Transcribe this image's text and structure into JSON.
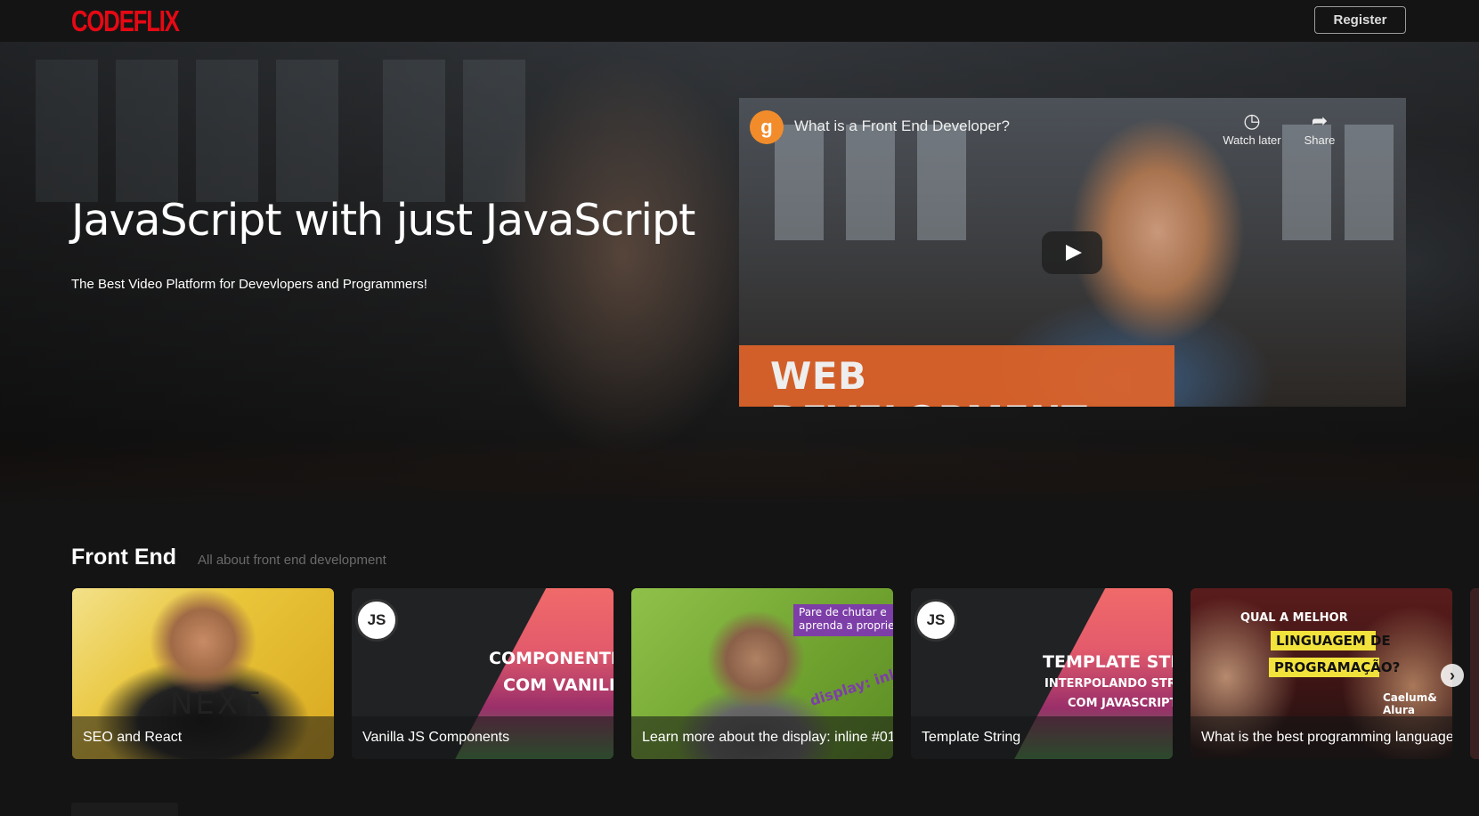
{
  "header": {
    "logo": "CODEFLIX",
    "register_label": "Register"
  },
  "hero": {
    "title": "JavaScript with just JavaScript",
    "subtitle": "The Best Video Platform for Devevlopers and Programmers!"
  },
  "video": {
    "channel_icon": "g",
    "title": "What is a Front End Developer?",
    "watch_later_label": "Watch later",
    "watch_later_icon": "clock-icon",
    "share_label": "Share",
    "share_icon": "share-arrow-icon",
    "banner_text": "WEB DEVELOPMENT"
  },
  "section": {
    "title": "Front End",
    "subtitle": "All about front end development"
  },
  "cards": [
    {
      "title": "SEO and React",
      "overlay": "NEXT"
    },
    {
      "title": "Vanilla JS Components",
      "overlay_line1": "COMPONENTIZAÇ",
      "overlay_line2": "COM VANILLAJS",
      "badge": "JS"
    },
    {
      "title": "Learn more about the display: inline #01",
      "overlay_line1": "Pare de chutar e",
      "overlay_line2": "aprenda a propriedade",
      "overlay_line3": "display: inline"
    },
    {
      "title": "Template String",
      "overlay_line1": "TEMPLATE STRIN",
      "overlay_line2": "INTERPOLANDO STRIN",
      "overlay_line3": "COM JAVASCRIPT",
      "badge": "JS"
    },
    {
      "title": "What is the best programming language",
      "overlay_line1": "QUAL A MELHOR",
      "overlay_line2": "LINGUAGEM DE",
      "overlay_line3": "PROGRAMAÇÃO?",
      "overlay_line4": "Caelum&",
      "overlay_line5": "Alura"
    }
  ],
  "colors": {
    "brand": "#e50914",
    "background": "#141414",
    "video_banner": "#e0642a"
  }
}
